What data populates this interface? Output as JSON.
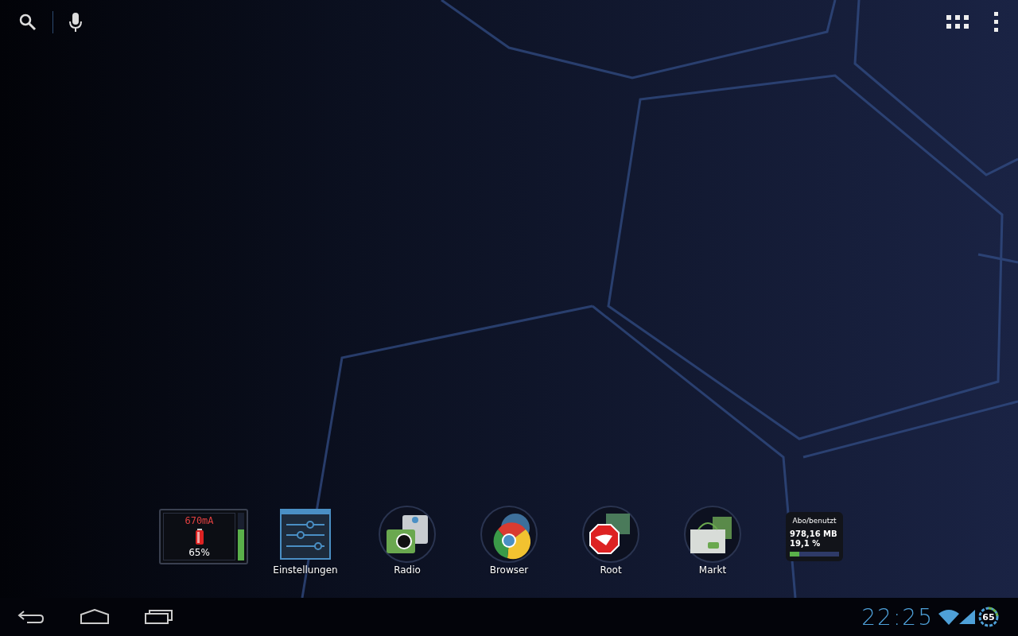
{
  "dock": [
    {
      "kind": "battery_widget",
      "current": "670mA",
      "percent": "65%",
      "level": 0.65
    },
    {
      "kind": "app",
      "label": "Einstellungen"
    },
    {
      "kind": "app",
      "label": "Radio"
    },
    {
      "kind": "app",
      "label": "Browser"
    },
    {
      "kind": "app",
      "label": "Root"
    },
    {
      "kind": "app",
      "label": "Markt"
    },
    {
      "kind": "data_widget",
      "title": "Abo/benutzt",
      "amount": "978,16 MB",
      "percent": "19,1 %",
      "level": 0.191
    }
  ],
  "status_bar": {
    "time": "22:25",
    "battery": "65"
  }
}
